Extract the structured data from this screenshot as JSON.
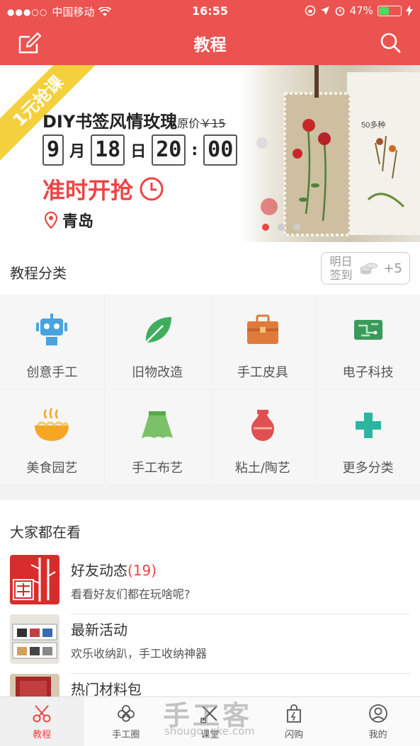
{
  "status_bar": {
    "signal": "●●●○○",
    "carrier": "中国移动",
    "time": "16:55",
    "battery_percent": "47%",
    "battery_level": 0.47
  },
  "header": {
    "title": "教程",
    "edit_icon": "edit-icon",
    "search_icon": "search-icon"
  },
  "banner": {
    "ribbon": "1元抢课",
    "title": "DIY书签风情玫瑰",
    "original_price_label": "原价",
    "original_price": "￥15",
    "month": "9",
    "month_unit": "月",
    "day": "18",
    "day_unit": "日",
    "hour": "20",
    "colon": ":",
    "minute": "00",
    "cta": "准时开抢",
    "city": "青岛",
    "page_count": 3,
    "active_page": 0
  },
  "categories": {
    "title": "教程分类",
    "signin_line1": "明日",
    "signin_line2": "签到",
    "signin_bonus": "+5",
    "items": [
      {
        "label": "创意手工",
        "icon": "robot-icon",
        "color": "#4aa3df"
      },
      {
        "label": "旧物改造",
        "icon": "leaf-icon",
        "color": "#3fae5c"
      },
      {
        "label": "手工皮具",
        "icon": "briefcase-icon",
        "color": "#e07a3a"
      },
      {
        "label": "电子科技",
        "icon": "circuit-icon",
        "color": "#3a9a5a"
      },
      {
        "label": "美食园艺",
        "icon": "noodle-bowl-icon",
        "color": "#f5a623"
      },
      {
        "label": "手工布艺",
        "icon": "skirt-icon",
        "color": "#7cc16a"
      },
      {
        "label": "粘土/陶艺",
        "icon": "vase-icon",
        "color": "#e05050"
      },
      {
        "label": "更多分类",
        "icon": "plus-icon",
        "color": "#2bb5a0"
      }
    ]
  },
  "feed": {
    "title": "大家都在看",
    "items": [
      {
        "title": "好友动态",
        "count": "(19)",
        "subtitle": "看看好友们都在玩啥呢?",
        "thumb": "bamboo-stamp-thumbnail"
      },
      {
        "title": "最新活动",
        "count": "",
        "subtitle": "欢乐收纳趴，手工收纳神器",
        "thumb": "storage-shelf-thumbnail"
      },
      {
        "title": "热门材料包",
        "count": "",
        "subtitle": "",
        "thumb": "material-pack-thumbnail"
      }
    ]
  },
  "tabs": [
    {
      "label": "教程",
      "icon": "scissors-icon",
      "active": true
    },
    {
      "label": "手工圈",
      "icon": "flower-icon",
      "active": false
    },
    {
      "label": "课堂",
      "icon": "pencil-ruler-icon",
      "active": false
    },
    {
      "label": "闪购",
      "icon": "shopping-bag-icon",
      "active": false
    },
    {
      "label": "我的",
      "icon": "user-icon",
      "active": false
    }
  ],
  "watermark": {
    "text": "手工客",
    "url": "shougongke.com"
  }
}
